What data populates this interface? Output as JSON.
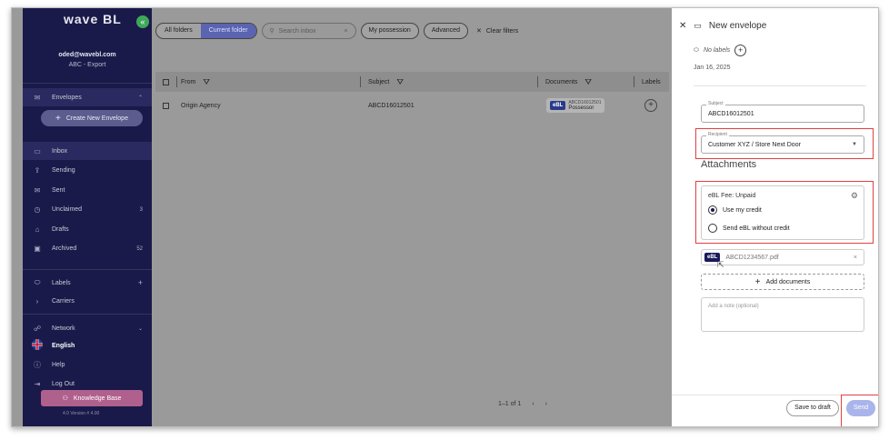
{
  "sidebar": {
    "logo": "wave BL",
    "collapse_glyph": "«",
    "account_email": "oded@wavebl.com",
    "account_org": "ABC - Export",
    "envelopes_label": "Envelopes",
    "create_label": "Create New Envelope",
    "items": [
      {
        "label": "Inbox",
        "count": "",
        "icon": "inbox-icon",
        "glyph": "▭"
      },
      {
        "label": "Sending",
        "count": "",
        "icon": "sending-icon",
        "glyph": "⇪"
      },
      {
        "label": "Sent",
        "count": "",
        "icon": "sent-icon",
        "glyph": "✉"
      },
      {
        "label": "Unclaimed",
        "count": "3",
        "icon": "clock-icon",
        "glyph": "◷"
      },
      {
        "label": "Drafts",
        "count": "",
        "icon": "drafts-icon",
        "glyph": "⌂"
      },
      {
        "label": "Archived",
        "count": "52",
        "icon": "archive-icon",
        "glyph": "▣"
      }
    ],
    "labels_label": "Labels",
    "carriers_label": "Carriers",
    "network_label": "Network",
    "english_label": "English",
    "help_label": "Help",
    "logout_label": "Log Out",
    "kb_label": "Knowledge Base",
    "version": "4.0 Version # 4.00"
  },
  "toolbar": {
    "all_folders": "All folders",
    "current_folder": "Current folder",
    "search_placeholder": "Search inbox",
    "my_possession": "My possession",
    "advanced": "Advanced",
    "clear_filters": "Clear filters"
  },
  "table": {
    "headers": {
      "from": "From",
      "subject": "Subject",
      "documents": "Documents",
      "labels": "Labels"
    },
    "rows": [
      {
        "from": "Origin Agency",
        "subject": "ABCD16012501",
        "doc_tag": "eBL",
        "doc_number": "ABCD16012501",
        "doc_status": "Possessor"
      }
    ],
    "pager": "1–1 of 1",
    "prev": "‹",
    "next": "›"
  },
  "panel": {
    "title": "New envelope",
    "no_labels": "No labels",
    "date": "Jan 16, 2025",
    "subject_label": "Subject",
    "subject_value": "ABCD16012501",
    "recipient_label": "Recipient",
    "recipient_value": "Customer XYZ / Store Next Door",
    "attachments_title": "Attachments",
    "fee_title": "eBL Fee: Unpaid",
    "radio_credit": "Use my credit",
    "radio_no_credit": "Send eBL without credit",
    "radio_selected": "credit",
    "file_tag": "eBL",
    "file_name": "ABCD1234567.pdf",
    "add_documents": "Add documents",
    "note_placeholder": "Add a note (optional)",
    "save_draft": "Save to draft",
    "send": "Send"
  },
  "colors": {
    "sidebar_bg": "#1a1a4a",
    "accent": "#5a64b0",
    "send_button": "#a9b4ea",
    "highlight_box": "#e04040",
    "knowledge_base": "#b0608c"
  }
}
